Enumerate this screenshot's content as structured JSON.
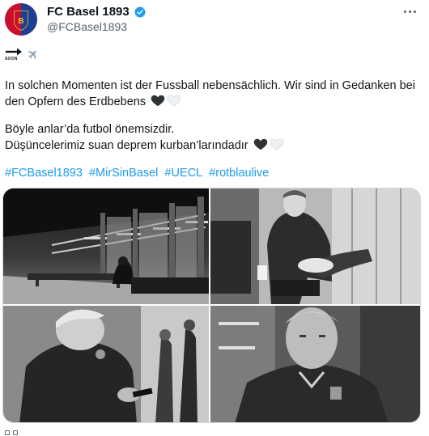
{
  "author": {
    "display_name": "FC Basel 1893",
    "handle": "@FCBasel1893",
    "verified": true,
    "avatar_colors": {
      "primary": "#c8102e",
      "secondary": "#1c3f94",
      "accent": "#f2c230"
    }
  },
  "teaser": {
    "arrow_label": "SOON",
    "icon": "airplane-icon"
  },
  "tweet": {
    "paragraph_de": "In solchen Momenten ist der Fussball nebensächlich. Wir sind in Gedanken bei den Opfern des Erdbebens",
    "paragraph_tr_line1": "Böyle anlar’da futbol önemsizdir.",
    "paragraph_tr_line2": "Düşüncelerimiz suan deprem kurban’larındadır",
    "hearts": [
      "black-heart-icon",
      "white-heart-icon"
    ],
    "hashtags": [
      "#FCBasel1893",
      "#MirSinBasel",
      "#UECL",
      "#rotblaulive"
    ]
  },
  "media": {
    "photos": [
      {
        "name": "photo-airport-terminal-waiting-area",
        "style": "black-and-white"
      },
      {
        "name": "photo-player-seated-crossed-legs",
        "style": "black-and-white"
      },
      {
        "name": "photo-player-looking-at-phone",
        "style": "black-and-white"
      },
      {
        "name": "photo-player-portrait-close-up",
        "style": "black-and-white"
      }
    ]
  },
  "colors": {
    "link": "#1d9bf0",
    "text": "#0f1419",
    "secondary_text": "#536471",
    "verified": "#1d9bf0"
  }
}
